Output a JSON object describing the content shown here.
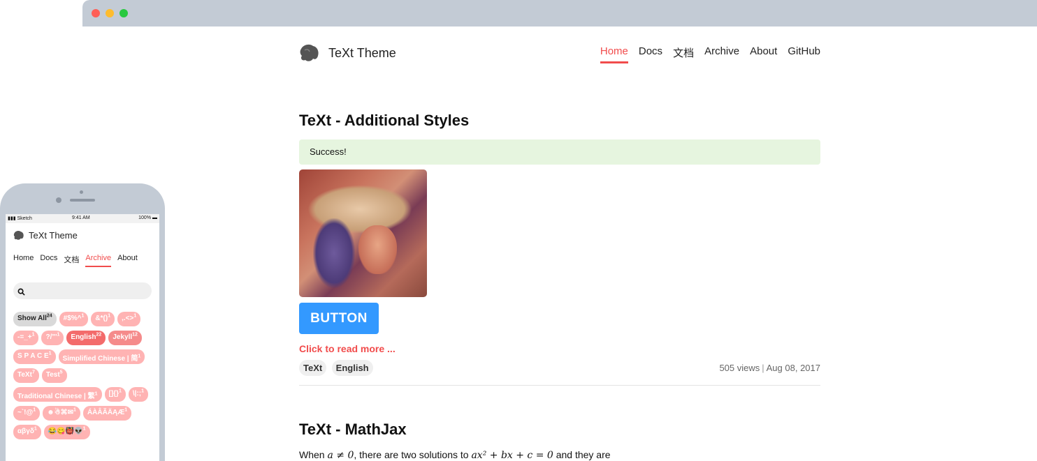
{
  "browser": {
    "brand": {
      "title": "TeXt Theme"
    },
    "nav": [
      {
        "label": "Home",
        "active": true
      },
      {
        "label": "Docs",
        "active": false
      },
      {
        "label": "文档",
        "active": false
      },
      {
        "label": "Archive",
        "active": false
      },
      {
        "label": "About",
        "active": false
      },
      {
        "label": "GitHub",
        "active": false
      }
    ],
    "post1": {
      "title": "TeXt - Additional Styles",
      "alert": "Success!",
      "button_label": "BUTTON",
      "read_more": "Click to read more ...",
      "tags": [
        "TeXt",
        "English"
      ],
      "views": "505 views",
      "separator": "|",
      "date": "Aug 08, 2017"
    },
    "post2": {
      "title": "TeXt - MathJax",
      "text_before": "When ",
      "math1": "a ≠ 0",
      "text_mid": ", there are two solutions to ",
      "math2": "ax² + bx + c = 0",
      "text_after": " and they are"
    }
  },
  "phone": {
    "status": {
      "carrier": "Sketch",
      "time": "9:41 AM",
      "battery": "100%"
    },
    "brand": {
      "title": "TeXt Theme"
    },
    "nav": [
      {
        "label": "Home",
        "active": false
      },
      {
        "label": "Docs",
        "active": false
      },
      {
        "label": "文档",
        "active": false
      },
      {
        "label": "Archive",
        "active": true
      },
      {
        "label": "About",
        "active": false
      }
    ],
    "search": {
      "placeholder": ""
    },
    "tags": [
      {
        "label": "Show All",
        "count": "24",
        "style": "gray"
      },
      {
        "label": "#$%^",
        "count": "1",
        "style": "light"
      },
      {
        "label": "&*()",
        "count": "1",
        "style": "light"
      },
      {
        "label": ",.<>",
        "count": "1",
        "style": "light"
      },
      {
        "label": "-=_+",
        "count": "1",
        "style": "light"
      },
      {
        "label": "?/\"'",
        "count": "1",
        "style": "light"
      },
      {
        "label": "English",
        "count": "22",
        "style": "strong"
      },
      {
        "label": "Jekyll",
        "count": "12",
        "style": "mid"
      },
      {
        "label": "S P A C E",
        "count": "1",
        "style": "light"
      },
      {
        "label": "Simplified Chinese | 简",
        "count": "1",
        "style": "light"
      },
      {
        "label": "TeXt",
        "count": "7",
        "style": "light"
      },
      {
        "label": "Test",
        "count": "5",
        "style": "light"
      },
      {
        "label": "Traditional Chinese | 繁",
        "count": "1",
        "style": "light"
      },
      {
        "label": "[]{}",
        "count": "1",
        "style": "light"
      },
      {
        "label": "\\|:;",
        "count": "1",
        "style": "light"
      },
      {
        "label": "~`!@",
        "count": "1",
        "style": "light"
      },
      {
        "label": "☻☃⌘✉",
        "count": "1",
        "style": "light"
      },
      {
        "label": "ÁÀÂÃÄĄÆ",
        "count": "1",
        "style": "light"
      },
      {
        "label": "αβγδ",
        "count": "1",
        "style": "light"
      },
      {
        "label": "😂😋👹👽",
        "count": "1",
        "style": "light"
      }
    ]
  },
  "colors": {
    "accent": "#f14c4c",
    "button": "#3399ff",
    "success_bg": "#e6f5df",
    "chrome": "#c3cbd5"
  }
}
